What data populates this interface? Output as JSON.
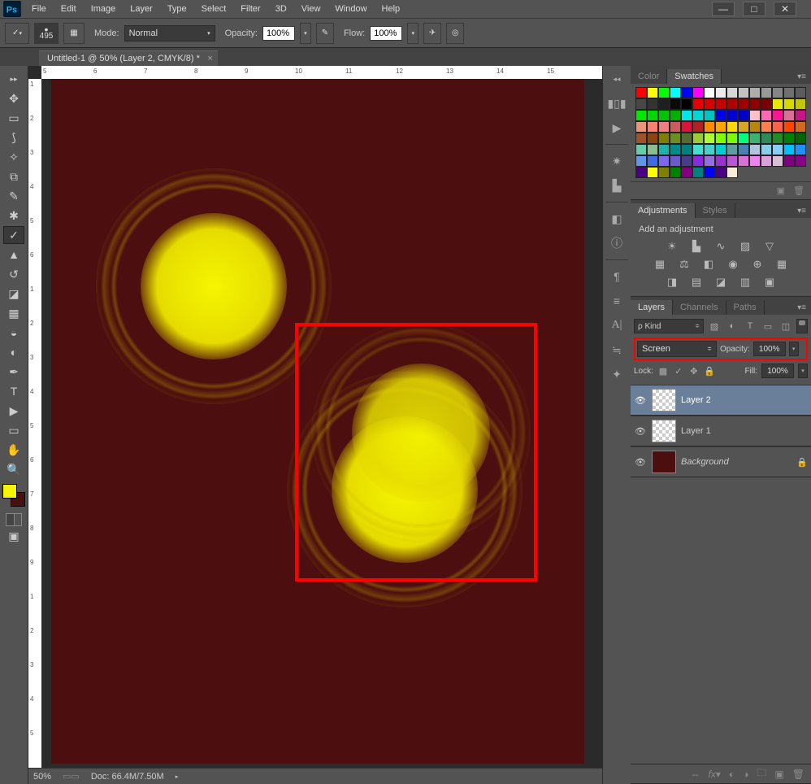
{
  "app": {
    "name": "Ps"
  },
  "menu": [
    "File",
    "Edit",
    "Image",
    "Layer",
    "Type",
    "Select",
    "Filter",
    "3D",
    "View",
    "Window",
    "Help"
  ],
  "window_controls": {
    "min": "—",
    "max": "□",
    "close": "✕"
  },
  "options": {
    "brush_size": "495",
    "mode_label": "Mode:",
    "mode_value": "Normal",
    "opacity_label": "Opacity:",
    "opacity_value": "100%",
    "flow_label": "Flow:",
    "flow_value": "100%"
  },
  "document": {
    "tab_title": "Untitled-1 @ 50% (Layer 2, CMYK/8) *",
    "zoom": "50%",
    "doc_size": "Doc: 66.4M/7.50M"
  },
  "ruler_h": [
    "5",
    "6",
    "7",
    "8",
    "9",
    "10",
    "11",
    "12",
    "13",
    "14",
    "15"
  ],
  "ruler_v": [
    "1",
    "2",
    "3",
    "4",
    "5",
    "6",
    "1",
    "2",
    "3",
    "4",
    "5",
    "6",
    "7",
    "8",
    "9",
    "1",
    "2",
    "3",
    "4",
    "5"
  ],
  "swatches": {
    "tab_color": "Color",
    "tab_swatches": "Swatches",
    "colors": [
      "#ff0000",
      "#ffff00",
      "#00ff00",
      "#00ffff",
      "#0000ff",
      "#ff00ff",
      "#ffffff",
      "#ebebeb",
      "#d6d6d6",
      "#c2c2c2",
      "#adadad",
      "#999999",
      "#858585",
      "#707070",
      "#5c5c5c",
      "#474747",
      "#333333",
      "#1f1f1f",
      "#0a0a0a",
      "#000000",
      "#e80000",
      "#d60000",
      "#c40000",
      "#b00000",
      "#9e0000",
      "#8b0000",
      "#780000",
      "#e8e800",
      "#d6d600",
      "#c4c400",
      "#00e800",
      "#00d600",
      "#00c400",
      "#00b000",
      "#00e8e8",
      "#00d6d6",
      "#00c4c4",
      "#0000e8",
      "#0000d6",
      "#0000c4",
      "#ffc0cb",
      "#ff69b4",
      "#ff1493",
      "#db7093",
      "#c71585",
      "#e9967a",
      "#fa8072",
      "#f08080",
      "#cd5c5c",
      "#dc143c",
      "#b22222",
      "#ff8c00",
      "#ffa500",
      "#ffd700",
      "#daa520",
      "#b8860b",
      "#ff7f50",
      "#ff6347",
      "#ff4500",
      "#d2691e",
      "#a0522d",
      "#8b4513",
      "#808000",
      "#6b8e23",
      "#556b2f",
      "#9acd32",
      "#adff2f",
      "#7fff00",
      "#7cfc00",
      "#00ff7f",
      "#3cb371",
      "#2e8b57",
      "#228b22",
      "#008000",
      "#006400",
      "#66cdaa",
      "#8fbc8f",
      "#20b2aa",
      "#008b8b",
      "#008080",
      "#40e0d0",
      "#48d1cc",
      "#00ced1",
      "#5f9ea0",
      "#4682b4",
      "#b0c4de",
      "#87ceeb",
      "#87cefa",
      "#00bfff",
      "#1e90ff",
      "#6495ed",
      "#4169e1",
      "#7b68ee",
      "#6a5acd",
      "#483d8b",
      "#8a2be2",
      "#9370db",
      "#9932cc",
      "#ba55d3",
      "#da70d6",
      "#ee82ee",
      "#dda0dd",
      "#d8bfd8",
      "#800080",
      "#8b008b",
      "#4b0082",
      "#ffff00",
      "#808000",
      "#008000",
      "#800080",
      "#008080",
      "#0000ff",
      "#4b0082",
      "#faebd7"
    ]
  },
  "adjustments": {
    "tab_adj": "Adjustments",
    "tab_styles": "Styles",
    "add_label": "Add an adjustment"
  },
  "layers_panel": {
    "tab_layers": "Layers",
    "tab_channels": "Channels",
    "tab_paths": "Paths",
    "kind_label": "Kind",
    "blend_mode": "Screen",
    "opacity_label": "Opacity:",
    "opacity_value": "100%",
    "lock_label": "Lock:",
    "fill_label": "Fill:",
    "fill_value": "100%",
    "layers": [
      {
        "name": "Layer 2",
        "checker": true,
        "selected": true
      },
      {
        "name": "Layer 1",
        "checker": true,
        "selected": false
      },
      {
        "name": "Background",
        "checker": false,
        "selected": false,
        "locked": true,
        "bg": true
      }
    ]
  }
}
